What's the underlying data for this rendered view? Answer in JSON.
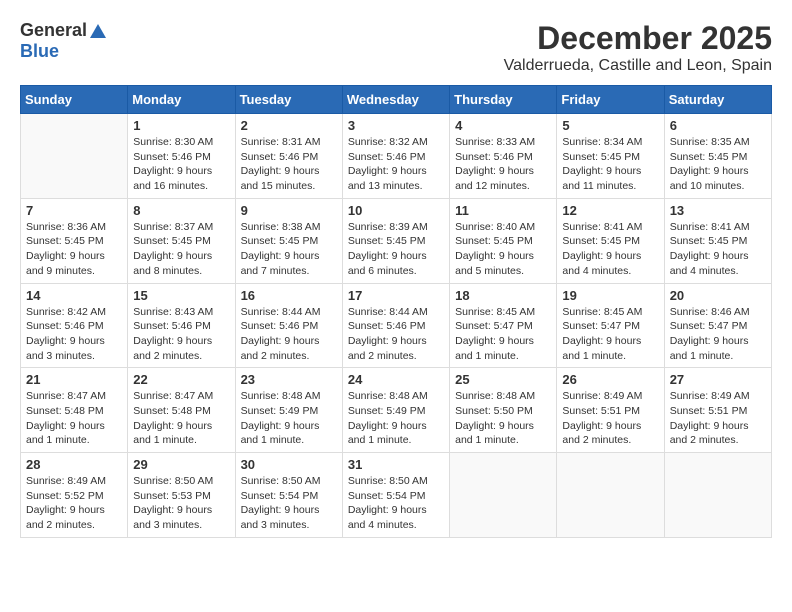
{
  "header": {
    "logo_general": "General",
    "logo_blue": "Blue",
    "month": "December 2025",
    "location": "Valderrueda, Castille and Leon, Spain"
  },
  "weekdays": [
    "Sunday",
    "Monday",
    "Tuesday",
    "Wednesday",
    "Thursday",
    "Friday",
    "Saturday"
  ],
  "weeks": [
    [
      {
        "day": "",
        "sunrise": "",
        "sunset": "",
        "daylight": ""
      },
      {
        "day": "1",
        "sunrise": "Sunrise: 8:30 AM",
        "sunset": "Sunset: 5:46 PM",
        "daylight": "Daylight: 9 hours and 16 minutes."
      },
      {
        "day": "2",
        "sunrise": "Sunrise: 8:31 AM",
        "sunset": "Sunset: 5:46 PM",
        "daylight": "Daylight: 9 hours and 15 minutes."
      },
      {
        "day": "3",
        "sunrise": "Sunrise: 8:32 AM",
        "sunset": "Sunset: 5:46 PM",
        "daylight": "Daylight: 9 hours and 13 minutes."
      },
      {
        "day": "4",
        "sunrise": "Sunrise: 8:33 AM",
        "sunset": "Sunset: 5:46 PM",
        "daylight": "Daylight: 9 hours and 12 minutes."
      },
      {
        "day": "5",
        "sunrise": "Sunrise: 8:34 AM",
        "sunset": "Sunset: 5:45 PM",
        "daylight": "Daylight: 9 hours and 11 minutes."
      },
      {
        "day": "6",
        "sunrise": "Sunrise: 8:35 AM",
        "sunset": "Sunset: 5:45 PM",
        "daylight": "Daylight: 9 hours and 10 minutes."
      }
    ],
    [
      {
        "day": "7",
        "sunrise": "Sunrise: 8:36 AM",
        "sunset": "Sunset: 5:45 PM",
        "daylight": "Daylight: 9 hours and 9 minutes."
      },
      {
        "day": "8",
        "sunrise": "Sunrise: 8:37 AM",
        "sunset": "Sunset: 5:45 PM",
        "daylight": "Daylight: 9 hours and 8 minutes."
      },
      {
        "day": "9",
        "sunrise": "Sunrise: 8:38 AM",
        "sunset": "Sunset: 5:45 PM",
        "daylight": "Daylight: 9 hours and 7 minutes."
      },
      {
        "day": "10",
        "sunrise": "Sunrise: 8:39 AM",
        "sunset": "Sunset: 5:45 PM",
        "daylight": "Daylight: 9 hours and 6 minutes."
      },
      {
        "day": "11",
        "sunrise": "Sunrise: 8:40 AM",
        "sunset": "Sunset: 5:45 PM",
        "daylight": "Daylight: 9 hours and 5 minutes."
      },
      {
        "day": "12",
        "sunrise": "Sunrise: 8:41 AM",
        "sunset": "Sunset: 5:45 PM",
        "daylight": "Daylight: 9 hours and 4 minutes."
      },
      {
        "day": "13",
        "sunrise": "Sunrise: 8:41 AM",
        "sunset": "Sunset: 5:45 PM",
        "daylight": "Daylight: 9 hours and 4 minutes."
      }
    ],
    [
      {
        "day": "14",
        "sunrise": "Sunrise: 8:42 AM",
        "sunset": "Sunset: 5:46 PM",
        "daylight": "Daylight: 9 hours and 3 minutes."
      },
      {
        "day": "15",
        "sunrise": "Sunrise: 8:43 AM",
        "sunset": "Sunset: 5:46 PM",
        "daylight": "Daylight: 9 hours and 2 minutes."
      },
      {
        "day": "16",
        "sunrise": "Sunrise: 8:44 AM",
        "sunset": "Sunset: 5:46 PM",
        "daylight": "Daylight: 9 hours and 2 minutes."
      },
      {
        "day": "17",
        "sunrise": "Sunrise: 8:44 AM",
        "sunset": "Sunset: 5:46 PM",
        "daylight": "Daylight: 9 hours and 2 minutes."
      },
      {
        "day": "18",
        "sunrise": "Sunrise: 8:45 AM",
        "sunset": "Sunset: 5:47 PM",
        "daylight": "Daylight: 9 hours and 1 minute."
      },
      {
        "day": "19",
        "sunrise": "Sunrise: 8:45 AM",
        "sunset": "Sunset: 5:47 PM",
        "daylight": "Daylight: 9 hours and 1 minute."
      },
      {
        "day": "20",
        "sunrise": "Sunrise: 8:46 AM",
        "sunset": "Sunset: 5:47 PM",
        "daylight": "Daylight: 9 hours and 1 minute."
      }
    ],
    [
      {
        "day": "21",
        "sunrise": "Sunrise: 8:47 AM",
        "sunset": "Sunset: 5:48 PM",
        "daylight": "Daylight: 9 hours and 1 minute."
      },
      {
        "day": "22",
        "sunrise": "Sunrise: 8:47 AM",
        "sunset": "Sunset: 5:48 PM",
        "daylight": "Daylight: 9 hours and 1 minute."
      },
      {
        "day": "23",
        "sunrise": "Sunrise: 8:48 AM",
        "sunset": "Sunset: 5:49 PM",
        "daylight": "Daylight: 9 hours and 1 minute."
      },
      {
        "day": "24",
        "sunrise": "Sunrise: 8:48 AM",
        "sunset": "Sunset: 5:49 PM",
        "daylight": "Daylight: 9 hours and 1 minute."
      },
      {
        "day": "25",
        "sunrise": "Sunrise: 8:48 AM",
        "sunset": "Sunset: 5:50 PM",
        "daylight": "Daylight: 9 hours and 1 minute."
      },
      {
        "day": "26",
        "sunrise": "Sunrise: 8:49 AM",
        "sunset": "Sunset: 5:51 PM",
        "daylight": "Daylight: 9 hours and 2 minutes."
      },
      {
        "day": "27",
        "sunrise": "Sunrise: 8:49 AM",
        "sunset": "Sunset: 5:51 PM",
        "daylight": "Daylight: 9 hours and 2 minutes."
      }
    ],
    [
      {
        "day": "28",
        "sunrise": "Sunrise: 8:49 AM",
        "sunset": "Sunset: 5:52 PM",
        "daylight": "Daylight: 9 hours and 2 minutes."
      },
      {
        "day": "29",
        "sunrise": "Sunrise: 8:50 AM",
        "sunset": "Sunset: 5:53 PM",
        "daylight": "Daylight: 9 hours and 3 minutes."
      },
      {
        "day": "30",
        "sunrise": "Sunrise: 8:50 AM",
        "sunset": "Sunset: 5:54 PM",
        "daylight": "Daylight: 9 hours and 3 minutes."
      },
      {
        "day": "31",
        "sunrise": "Sunrise: 8:50 AM",
        "sunset": "Sunset: 5:54 PM",
        "daylight": "Daylight: 9 hours and 4 minutes."
      },
      {
        "day": "",
        "sunrise": "",
        "sunset": "",
        "daylight": ""
      },
      {
        "day": "",
        "sunrise": "",
        "sunset": "",
        "daylight": ""
      },
      {
        "day": "",
        "sunrise": "",
        "sunset": "",
        "daylight": ""
      }
    ]
  ]
}
